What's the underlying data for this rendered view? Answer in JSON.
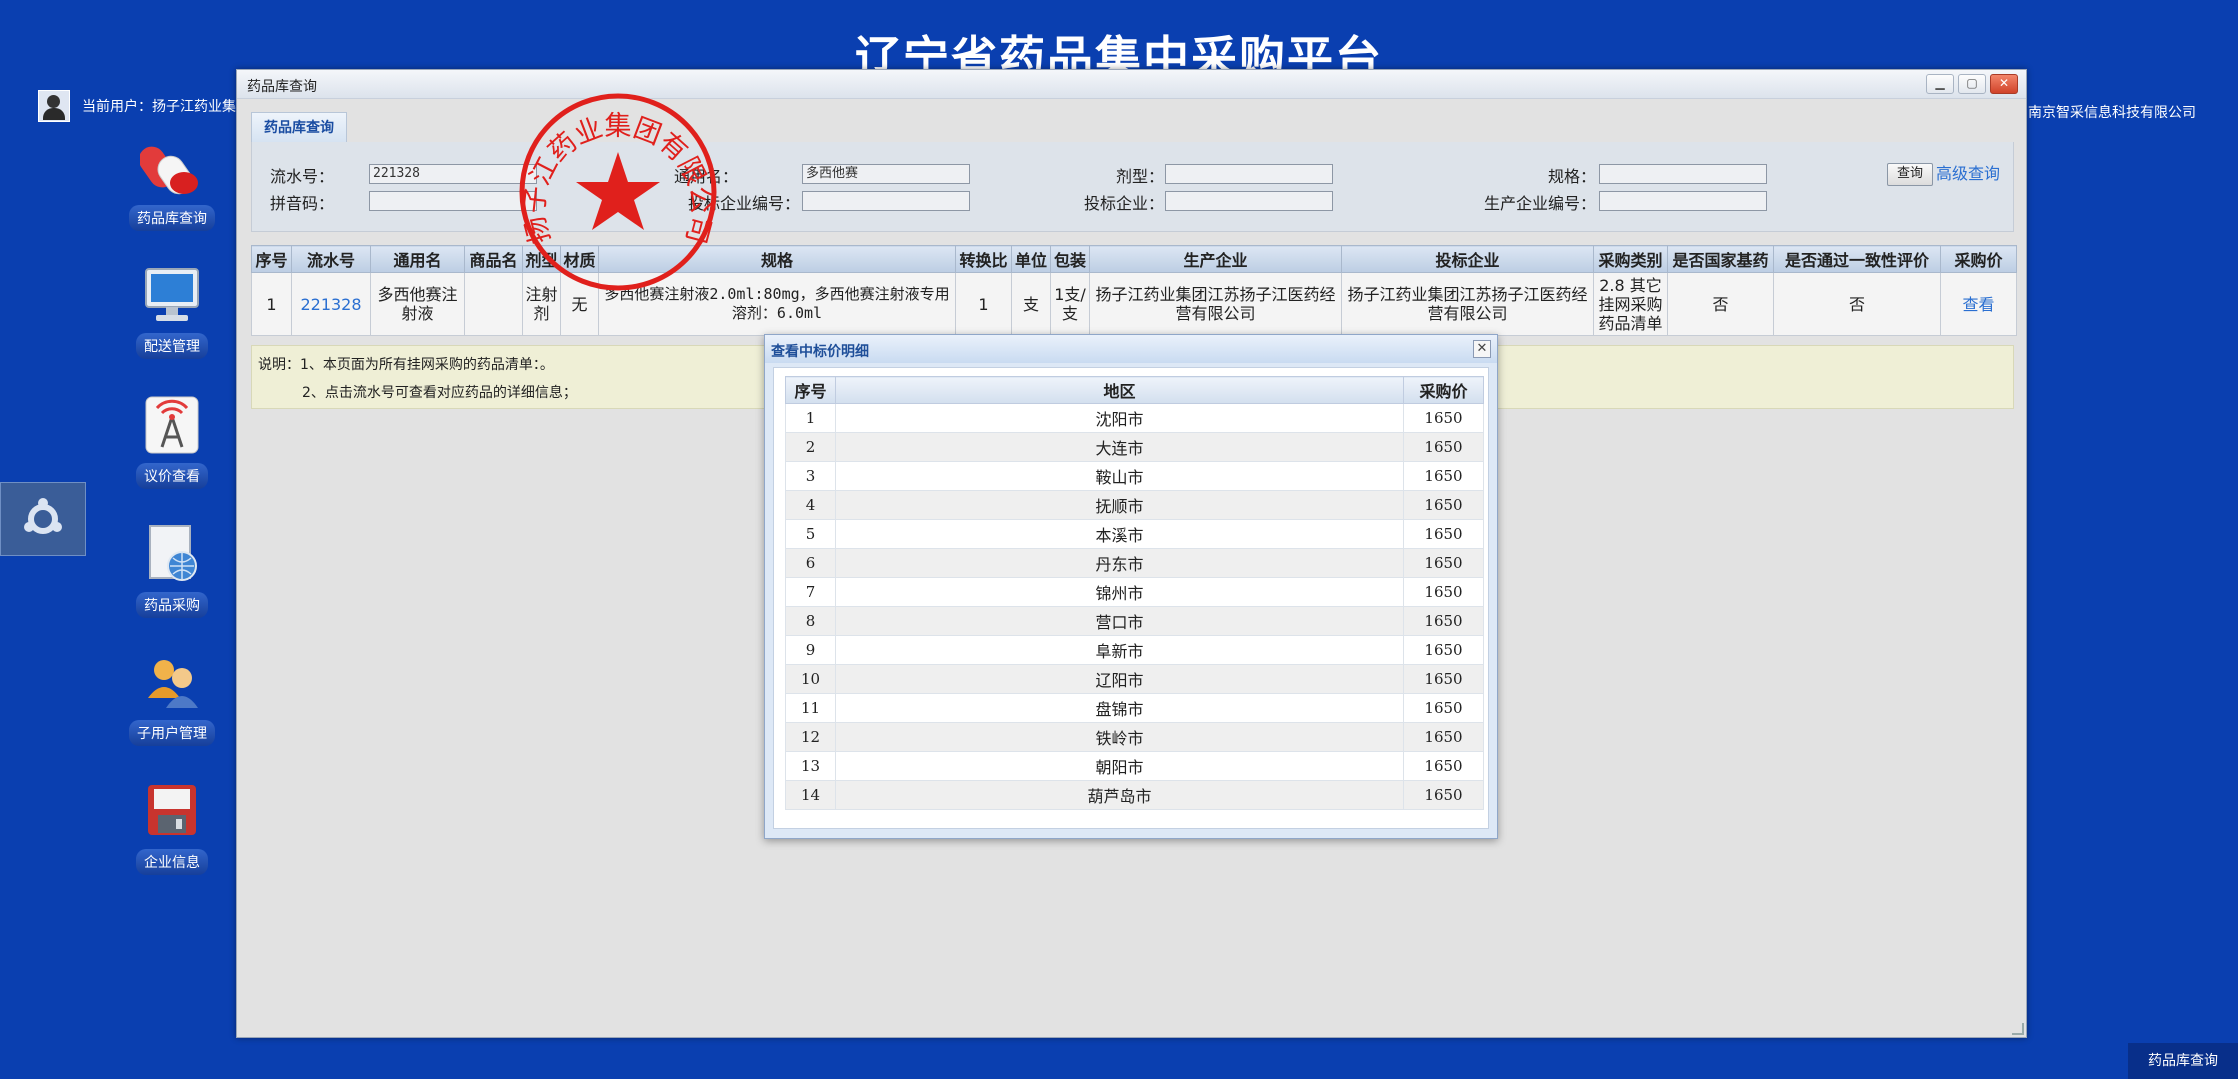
{
  "header": {
    "title": "辽宁省药品集中采购平台",
    "user_text": "当前用户：扬子江药业集",
    "vendor_text": "南京智采信息科技有限公司"
  },
  "nav": [
    {
      "label": "药品库查询",
      "icon": "pills-icon"
    },
    {
      "label": "配送管理",
      "icon": "monitor-icon"
    },
    {
      "label": "议价查看",
      "icon": "signal-tower-icon"
    },
    {
      "label": "药品采购",
      "icon": "globe-document-icon"
    },
    {
      "label": "子用户管理",
      "icon": "users-icon"
    },
    {
      "label": "企业信息",
      "icon": "floppy-disk-icon"
    }
  ],
  "window": {
    "title": "药品库查询",
    "tab": "药品库查询",
    "search": {
      "serial_label": "流水号：",
      "serial_value": "221328",
      "generic_label": "通用名：",
      "generic_value": "多西他赛",
      "form_label": "剂型：",
      "form_value": "",
      "spec_label": "规格：",
      "spec_value": "",
      "pinyin_label": "拼音码：",
      "pinyin_value": "",
      "bid_code_label": "投标企业编号：",
      "bid_code_value": "",
      "bid_company_label": "投标企业：",
      "bid_company_value": "",
      "maker_code_label": "生产企业编号：",
      "maker_code_value": "",
      "query_button": "查询",
      "advanced_link": "高级查询"
    },
    "table": {
      "columns": [
        "序号",
        "流水号",
        "通用名",
        "商品名",
        "剂型",
        "材质",
        "规格",
        "转换比",
        "单位",
        "包装",
        "生产企业",
        "投标企业",
        "采购类别",
        "是否国家基药",
        "是否通过一致性评价",
        "采购价"
      ],
      "rows": [
        [
          "1",
          "221328",
          "多西他赛注射液",
          "",
          "注射剂",
          "无",
          "多西他赛注射液2.0ml:80mg，多西他赛注射液专用溶剂：6.0ml",
          "1",
          "支",
          "1支/支",
          "扬子江药业集团江苏扬子江医药经营有限公司",
          "扬子江药业集团江苏扬子江医药经营有限公司",
          "2.8 其它挂网采购药品清单",
          "否",
          "否",
          "查看"
        ]
      ]
    },
    "notes": {
      "line1": "说明：1、本页面为所有挂网采购的药品清单：。",
      "line2": "2、点击流水号可查看对应药品的详细信息；"
    }
  },
  "seal": {
    "text": "扬子江药业集团有限公司",
    "color": "#e0201c"
  },
  "dialog": {
    "title": "查看中标价明细",
    "columns": [
      "序号",
      "地区",
      "采购价"
    ],
    "rows": [
      [
        "1",
        "沈阳市",
        "1650"
      ],
      [
        "2",
        "大连市",
        "1650"
      ],
      [
        "3",
        "鞍山市",
        "1650"
      ],
      [
        "4",
        "抚顺市",
        "1650"
      ],
      [
        "5",
        "本溪市",
        "1650"
      ],
      [
        "6",
        "丹东市",
        "1650"
      ],
      [
        "7",
        "锦州市",
        "1650"
      ],
      [
        "8",
        "营口市",
        "1650"
      ],
      [
        "9",
        "阜新市",
        "1650"
      ],
      [
        "10",
        "辽阳市",
        "1650"
      ],
      [
        "11",
        "盘锦市",
        "1650"
      ],
      [
        "12",
        "铁岭市",
        "1650"
      ],
      [
        "13",
        "朝阳市",
        "1650"
      ],
      [
        "14",
        "葫芦岛市",
        "1650"
      ]
    ]
  },
  "taskbar": {
    "active_tab": "药品库查询"
  },
  "colors": {
    "background": "#0a3fb0",
    "link": "#2a6fd1",
    "seal": "#e0201c"
  }
}
